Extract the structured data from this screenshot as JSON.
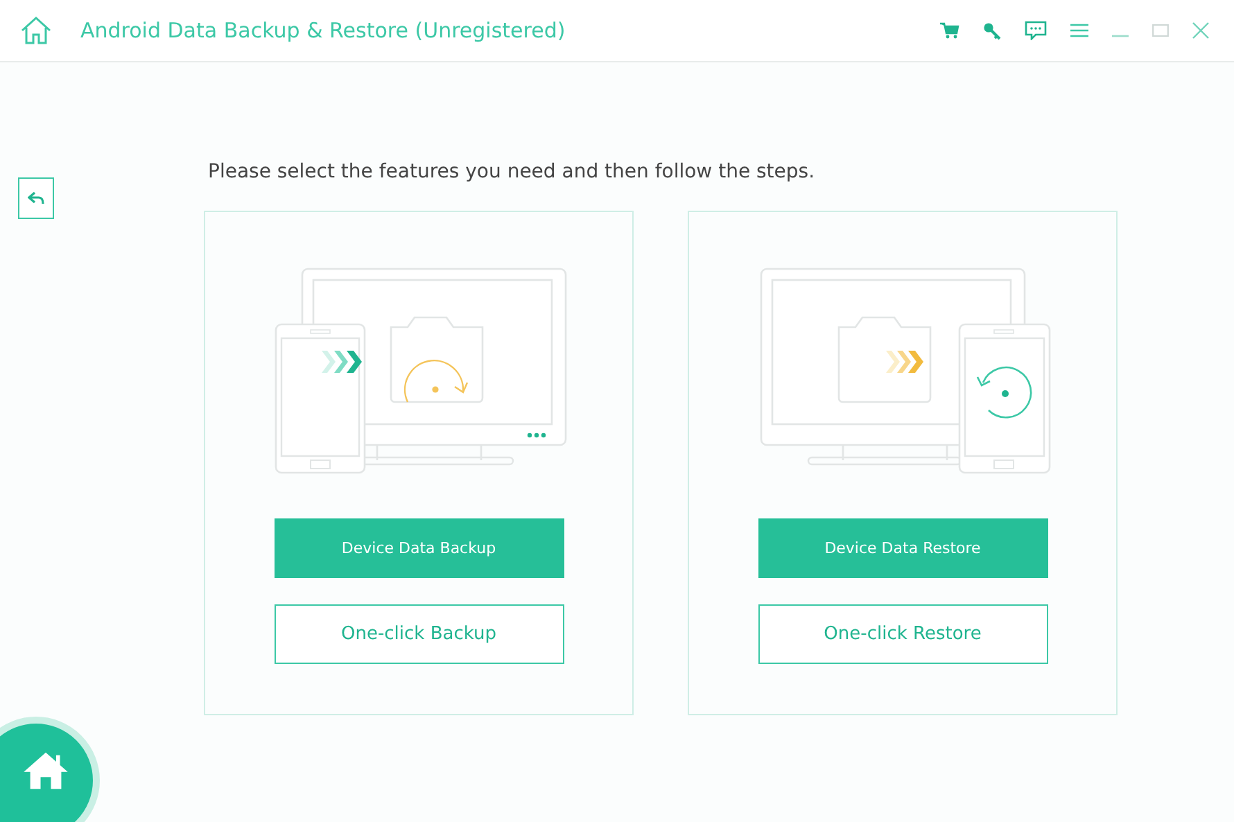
{
  "window": {
    "title": "Android Data Backup & Restore (Unregistered)"
  },
  "prompt": "Please select the features you need and then follow the steps.",
  "cards": [
    {
      "kind": "backup",
      "primary_button": "Device Data Backup",
      "secondary_button": "One-click Backup"
    },
    {
      "kind": "restore",
      "primary_button": "Device Data Restore",
      "secondary_button": "One-click Restore"
    }
  ]
}
